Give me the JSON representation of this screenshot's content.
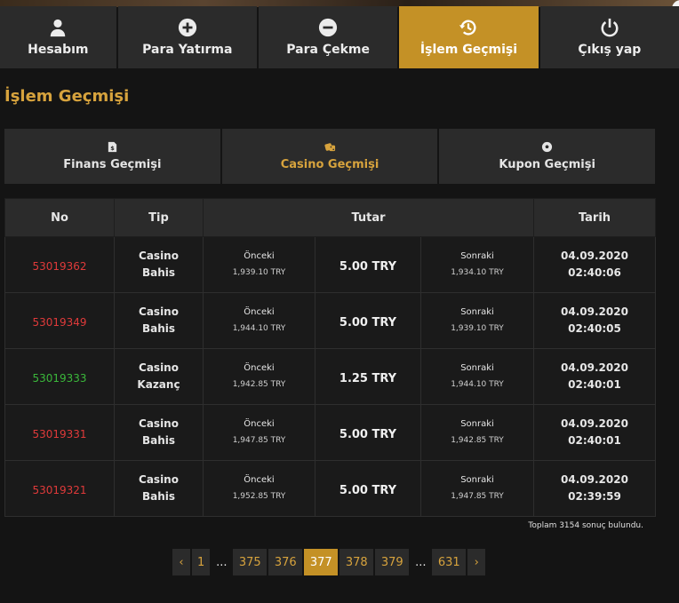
{
  "nav": {
    "items": [
      {
        "label": "Hesabım",
        "icon": "user-icon"
      },
      {
        "label": "Para Yatırma",
        "icon": "plus-circle-icon"
      },
      {
        "label": "Para Çekme",
        "icon": "minus-circle-icon"
      },
      {
        "label": "İşlem Geçmişi",
        "icon": "history-icon",
        "active": true
      },
      {
        "label": "Çıkış yap",
        "icon": "power-icon"
      }
    ]
  },
  "page": {
    "title": "İşlem Geçmişi"
  },
  "history_tabs": [
    {
      "label": "Finans Geçmişi",
      "icon": "document-money-icon"
    },
    {
      "label": "Casino Geçmişi",
      "icon": "dice-icon",
      "active": true
    },
    {
      "label": "Kupon Geçmişi",
      "icon": "soccer-ball-icon"
    }
  ],
  "table": {
    "headers": {
      "no": "No",
      "tip": "Tip",
      "tutar": "Tutar",
      "tarih": "Tarih"
    },
    "rows": [
      {
        "no": "53019362",
        "status": "loss",
        "type1": "Casino",
        "type2": "Bahis",
        "prev_label": "Önceki",
        "prev": "1,939.10 TRY",
        "amount": "5.00 TRY",
        "next_label": "Sonraki",
        "next": "1,934.10 TRY",
        "date": "04.09.2020",
        "time": "02:40:06"
      },
      {
        "no": "53019349",
        "status": "loss",
        "type1": "Casino",
        "type2": "Bahis",
        "prev_label": "Önceki",
        "prev": "1,944.10 TRY",
        "amount": "5.00 TRY",
        "next_label": "Sonraki",
        "next": "1,939.10 TRY",
        "date": "04.09.2020",
        "time": "02:40:05"
      },
      {
        "no": "53019333",
        "status": "win",
        "type1": "Casino",
        "type2": "Kazanç",
        "prev_label": "Önceki",
        "prev": "1,942.85 TRY",
        "amount": "1.25 TRY",
        "next_label": "Sonraki",
        "next": "1,944.10 TRY",
        "date": "04.09.2020",
        "time": "02:40:01"
      },
      {
        "no": "53019331",
        "status": "loss",
        "type1": "Casino",
        "type2": "Bahis",
        "prev_label": "Önceki",
        "prev": "1,947.85 TRY",
        "amount": "5.00 TRY",
        "next_label": "Sonraki",
        "next": "1,942.85 TRY",
        "date": "04.09.2020",
        "time": "02:40:01"
      },
      {
        "no": "53019321",
        "status": "loss",
        "type1": "Casino",
        "type2": "Bahis",
        "prev_label": "Önceki",
        "prev": "1,952.85 TRY",
        "amount": "5.00 TRY",
        "next_label": "Sonraki",
        "next": "1,947.85 TRY",
        "date": "04.09.2020",
        "time": "02:39:59"
      }
    ],
    "summary": "Toplam 3154 sonuç bulundu."
  },
  "pagination": {
    "prev": "‹",
    "next": "›",
    "items": [
      {
        "label": "1",
        "type": "num"
      },
      {
        "label": "...",
        "type": "ellipsis"
      },
      {
        "label": "375",
        "type": "num"
      },
      {
        "label": "376",
        "type": "num"
      },
      {
        "label": "377",
        "type": "num",
        "active": true
      },
      {
        "label": "378",
        "type": "num"
      },
      {
        "label": "379",
        "type": "num"
      },
      {
        "label": "...",
        "type": "ellipsis"
      },
      {
        "label": "631",
        "type": "num"
      }
    ]
  },
  "colors": {
    "accent": "#c49126",
    "title": "#d7a33d",
    "loss": "#e03a3a",
    "win": "#3bb83b"
  }
}
